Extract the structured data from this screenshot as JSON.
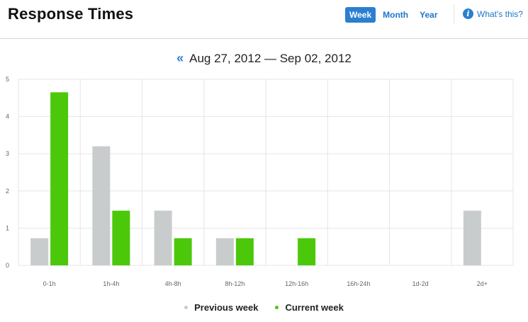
{
  "header": {
    "title": "Response Times",
    "periods": [
      "Week",
      "Month",
      "Year"
    ],
    "active_period": "Week",
    "whats_this": "What's this?",
    "info_glyph": "i"
  },
  "range": {
    "prev_glyph": "«",
    "label": "Aug 27, 2012 — Sep 02, 2012"
  },
  "colors": {
    "previous": "#c9cccd",
    "current": "#4cc80a",
    "grid": "#e6e6e6",
    "accent": "#2a7fd0"
  },
  "chart_data": {
    "type": "bar",
    "categories": [
      "0-1h",
      "1h-4h",
      "4h-8h",
      "8h-12h",
      "12h-16h",
      "16h-24h",
      "1d-2d",
      "2d+"
    ],
    "series": [
      {
        "name": "Previous week",
        "values": [
          0.73,
          3.2,
          1.47,
          0.73,
          0,
          0,
          0,
          1.47
        ]
      },
      {
        "name": "Current week",
        "values": [
          4.65,
          1.47,
          0.73,
          0.73,
          0.73,
          0,
          0,
          0
        ]
      }
    ],
    "yticks": [
      0,
      1,
      2,
      3,
      4,
      5
    ],
    "ylim": [
      0,
      5
    ],
    "grid": true,
    "legend": "bottom-center"
  }
}
